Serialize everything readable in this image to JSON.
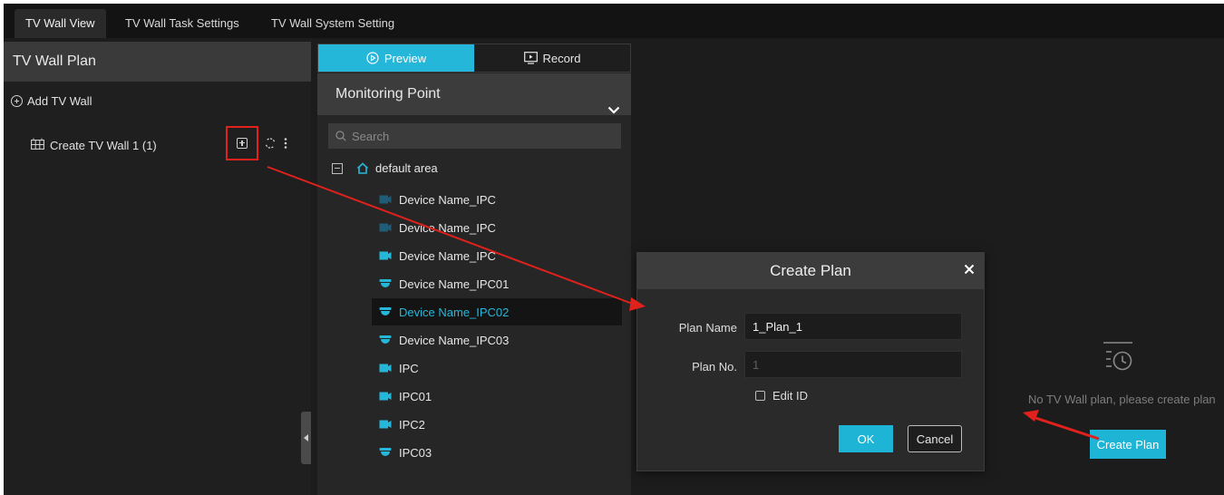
{
  "tabs": [
    {
      "label": "TV Wall View",
      "active": true
    },
    {
      "label": "TV Wall Task Settings",
      "active": false
    },
    {
      "label": "TV Wall System Setting",
      "active": false
    }
  ],
  "left_panel": {
    "title": "TV Wall Plan",
    "add_label": "Add TV Wall",
    "walls": [
      {
        "label": "Create TV Wall 1 (1)",
        "icon": "tv-wall-icon",
        "actions": [
          "add-plan-icon",
          "refresh-icon",
          "more-icon"
        ]
      }
    ]
  },
  "mid_panel": {
    "mode_tabs": [
      {
        "label": "Preview",
        "icon": "play-circle-icon",
        "active": true
      },
      {
        "label": "Record",
        "icon": "record-monitor-icon",
        "active": false
      }
    ],
    "section_title": "Monitoring Point",
    "search_placeholder": "Search",
    "area_label": "default area",
    "devices": [
      {
        "label": "Device Name_IPC",
        "icon": "bullet-camera-icon",
        "icon_color": "#1f5c78",
        "selected": false
      },
      {
        "label": "Device Name_IPC",
        "icon": "bullet-camera-icon",
        "icon_color": "#1f5c78",
        "selected": false
      },
      {
        "label": "Device Name_IPC",
        "icon": "bullet-camera-icon",
        "icon_color": "#25b7d9",
        "selected": false
      },
      {
        "label": "Device Name_IPC01",
        "icon": "dome-camera-icon",
        "icon_color": "#25b7d9",
        "selected": false
      },
      {
        "label": "Device Name_IPC02",
        "icon": "dome-camera-icon",
        "icon_color": "#25b7d9",
        "selected": true
      },
      {
        "label": "Device Name_IPC03",
        "icon": "dome-camera-icon",
        "icon_color": "#25b7d9",
        "selected": false
      },
      {
        "label": "IPC",
        "icon": "bullet-camera-icon",
        "icon_color": "#25b7d9",
        "selected": false
      },
      {
        "label": "IPC01",
        "icon": "bullet-camera-icon",
        "icon_color": "#25b7d9",
        "selected": false
      },
      {
        "label": "IPC2",
        "icon": "bullet-camera-icon",
        "icon_color": "#25b7d9",
        "selected": false
      },
      {
        "label": "IPC03",
        "icon": "dome-camera-icon",
        "icon_color": "#25b7d9",
        "selected": false
      }
    ]
  },
  "empty_state": {
    "text": "No TV Wall plan, please create plan",
    "button_label": "Create Plan"
  },
  "dialog": {
    "title": "Create Plan",
    "plan_name_label": "Plan Name",
    "plan_name_value": "1_Plan_1",
    "plan_no_label": "Plan No.",
    "plan_no_value": "1",
    "edit_id_label": "Edit ID",
    "edit_id_checked": false,
    "ok_label": "OK",
    "cancel_label": "Cancel"
  },
  "colors": {
    "accent": "#25b7d9",
    "highlight": "#e0211c",
    "background": "#1c1c1c"
  }
}
